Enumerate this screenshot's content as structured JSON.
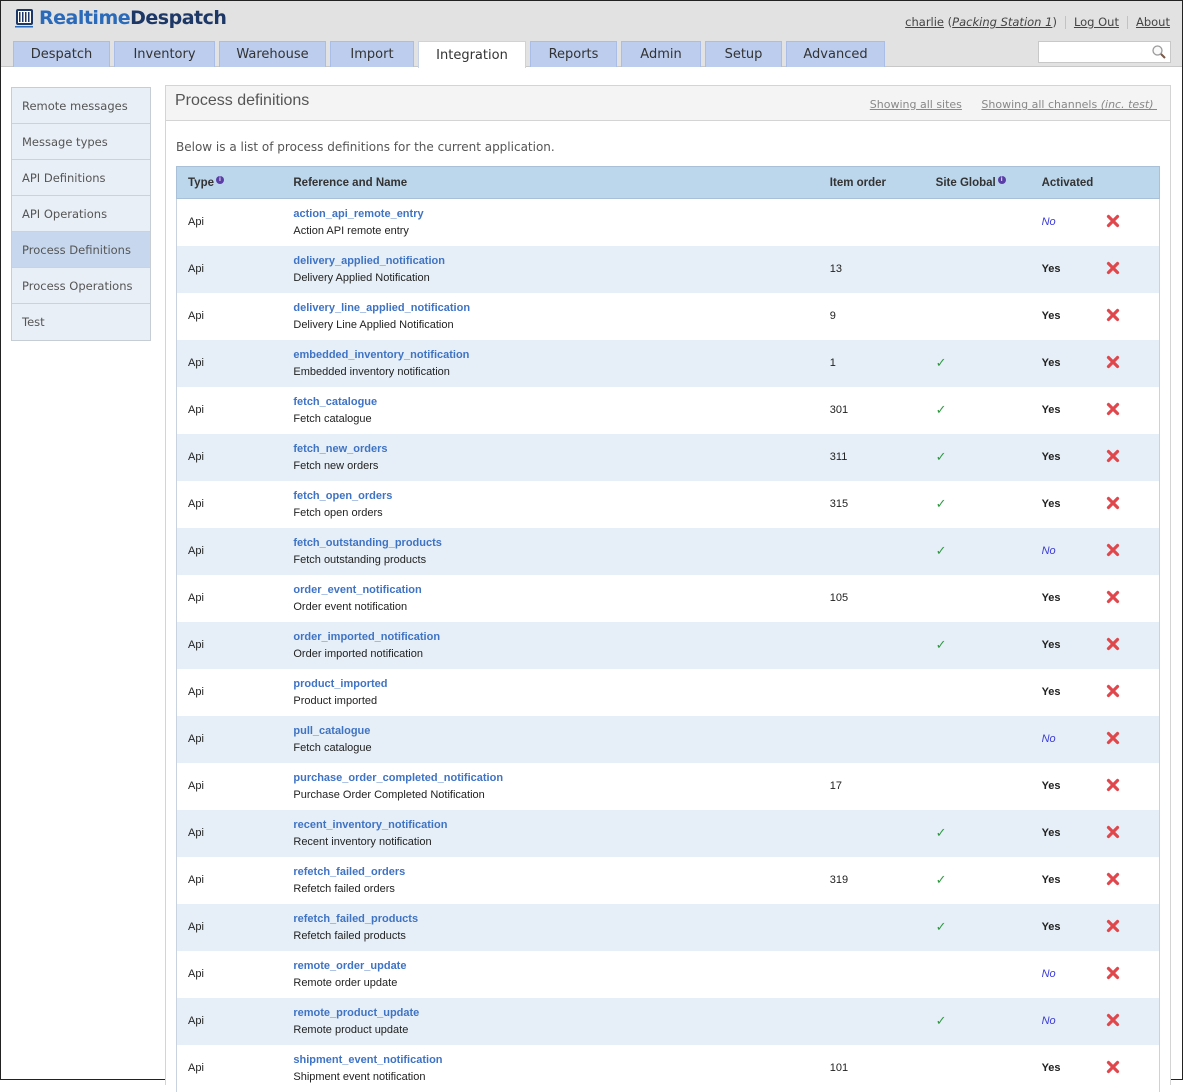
{
  "brand": {
    "part1": "Realtime",
    "part2": "Despatch"
  },
  "user": {
    "name": "charlie",
    "station": "Packing Station 1",
    "logout": "Log Out",
    "about": "About"
  },
  "tabs": [
    {
      "label": "Despatch"
    },
    {
      "label": "Inventory"
    },
    {
      "label": "Warehouse"
    },
    {
      "label": "Import"
    },
    {
      "label": "Integration",
      "active": true
    },
    {
      "label": "Reports"
    },
    {
      "label": "Admin"
    },
    {
      "label": "Setup"
    },
    {
      "label": "Advanced"
    }
  ],
  "search": {
    "placeholder": "",
    "value": ""
  },
  "sidebar": {
    "items": [
      {
        "label": "Remote messages"
      },
      {
        "label": "Message types"
      },
      {
        "label": "API Definitions"
      },
      {
        "label": "API Operations"
      },
      {
        "label": "Process Definitions",
        "active": true
      },
      {
        "label": "Process Operations"
      },
      {
        "label": "Test"
      }
    ]
  },
  "main": {
    "title": "Process definitions",
    "filter_sites": "Showing all sites",
    "filter_channels": "Showing all channels",
    "filter_channels_note": "(inc. test)",
    "intro": "Below is a list of process definitions for the current application.",
    "columns": {
      "type": "Type",
      "ref": "Reference and Name",
      "order": "Item order",
      "global": "Site Global",
      "activated": "Activated"
    },
    "rows": [
      {
        "type": "Api",
        "ref": "action_api_remote_entry",
        "name": "Action API remote entry",
        "order": "",
        "global": false,
        "activated": "No"
      },
      {
        "type": "Api",
        "ref": "delivery_applied_notification",
        "name": "Delivery Applied Notification",
        "order": "13",
        "global": false,
        "activated": "Yes"
      },
      {
        "type": "Api",
        "ref": "delivery_line_applied_notification",
        "name": "Delivery Line Applied Notification",
        "order": "9",
        "global": false,
        "activated": "Yes"
      },
      {
        "type": "Api",
        "ref": "embedded_inventory_notification",
        "name": "Embedded inventory notification",
        "order": "1",
        "global": true,
        "activated": "Yes"
      },
      {
        "type": "Api",
        "ref": "fetch_catalogue",
        "name": "Fetch catalogue",
        "order": "301",
        "global": true,
        "activated": "Yes"
      },
      {
        "type": "Api",
        "ref": "fetch_new_orders",
        "name": "Fetch new orders",
        "order": "311",
        "global": true,
        "activated": "Yes"
      },
      {
        "type": "Api",
        "ref": "fetch_open_orders",
        "name": "Fetch open orders",
        "order": "315",
        "global": true,
        "activated": "Yes"
      },
      {
        "type": "Api",
        "ref": "fetch_outstanding_products",
        "name": "Fetch outstanding products",
        "order": "",
        "global": true,
        "activated": "No"
      },
      {
        "type": "Api",
        "ref": "order_event_notification",
        "name": "Order event notification",
        "order": "105",
        "global": false,
        "activated": "Yes"
      },
      {
        "type": "Api",
        "ref": "order_imported_notification",
        "name": "Order imported notification",
        "order": "",
        "global": true,
        "activated": "Yes"
      },
      {
        "type": "Api",
        "ref": "product_imported",
        "name": "Product imported",
        "order": "",
        "global": false,
        "activated": "Yes"
      },
      {
        "type": "Api",
        "ref": "pull_catalogue",
        "name": "Fetch catalogue",
        "order": "",
        "global": false,
        "activated": "No"
      },
      {
        "type": "Api",
        "ref": "purchase_order_completed_notification",
        "name": "Purchase Order Completed Notification",
        "order": "17",
        "global": false,
        "activated": "Yes"
      },
      {
        "type": "Api",
        "ref": "recent_inventory_notification",
        "name": "Recent inventory notification",
        "order": "",
        "global": true,
        "activated": "Yes"
      },
      {
        "type": "Api",
        "ref": "refetch_failed_orders",
        "name": "Refetch failed orders",
        "order": "319",
        "global": true,
        "activated": "Yes"
      },
      {
        "type": "Api",
        "ref": "refetch_failed_products",
        "name": "Refetch failed products",
        "order": "",
        "global": true,
        "activated": "Yes"
      },
      {
        "type": "Api",
        "ref": "remote_order_update",
        "name": "Remote order update",
        "order": "",
        "global": false,
        "activated": "No"
      },
      {
        "type": "Api",
        "ref": "remote_product_update",
        "name": "Remote product update",
        "order": "",
        "global": true,
        "activated": "No"
      },
      {
        "type": "Api",
        "ref": "shipment_event_notification",
        "name": "Shipment event notification",
        "order": "101",
        "global": false,
        "activated": "Yes"
      }
    ]
  },
  "colors": {
    "link": "#3f73c4",
    "tab": "#bccdee",
    "header_row": "#bcd6ec",
    "alt_row": "#e6eff7",
    "check": "#2f9a42",
    "delete": "#e0474c",
    "no_text": "#3a3ad8"
  }
}
